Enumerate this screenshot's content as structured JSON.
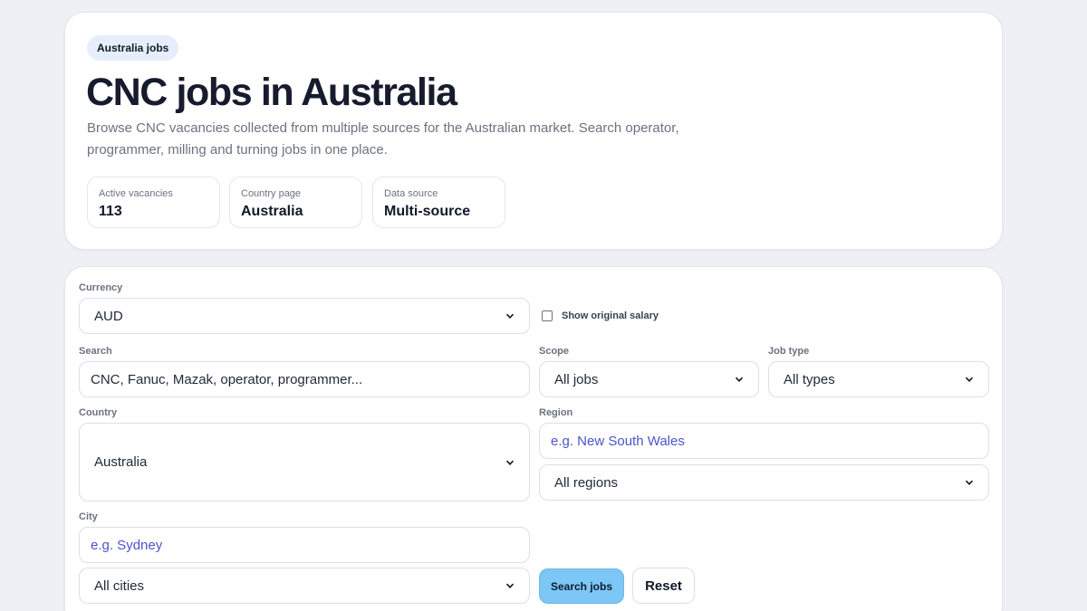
{
  "hero": {
    "badge": "Australia jobs",
    "title": "CNC jobs in Australia",
    "description": "Browse CNC vacancies collected from multiple sources for the Australian market. Search operator, programmer, milling and turning jobs in one place.",
    "stats": [
      {
        "label": "Active vacancies",
        "value": "113"
      },
      {
        "label": "Country page",
        "value": "Australia"
      },
      {
        "label": "Data source",
        "value": "Multi-source"
      }
    ]
  },
  "filters": {
    "currency": {
      "label": "Currency",
      "value": "AUD"
    },
    "show_original": {
      "label": "Show original salary",
      "checked": false
    },
    "search": {
      "label": "Search",
      "placeholder": "CNC, Fanuc, Mazak, operator, programmer..."
    },
    "scope": {
      "label": "Scope",
      "value": "All jobs"
    },
    "job_type": {
      "label": "Job type",
      "value": "All types"
    },
    "country": {
      "label": "Country",
      "value": "Australia"
    },
    "region": {
      "label": "Region",
      "placeholder": "e.g. New South Wales",
      "select_value": "All regions"
    },
    "city": {
      "label": "City",
      "placeholder": "e.g. Sydney",
      "select_value": "All cities"
    },
    "search_button": "Search jobs",
    "reset_button": "Reset"
  },
  "colors": {
    "accent_button": "#7cc7f5",
    "placeholder_text": "#4b55c9",
    "badge_bg": "#e6eefc",
    "page_bg": "#eef0f5"
  }
}
